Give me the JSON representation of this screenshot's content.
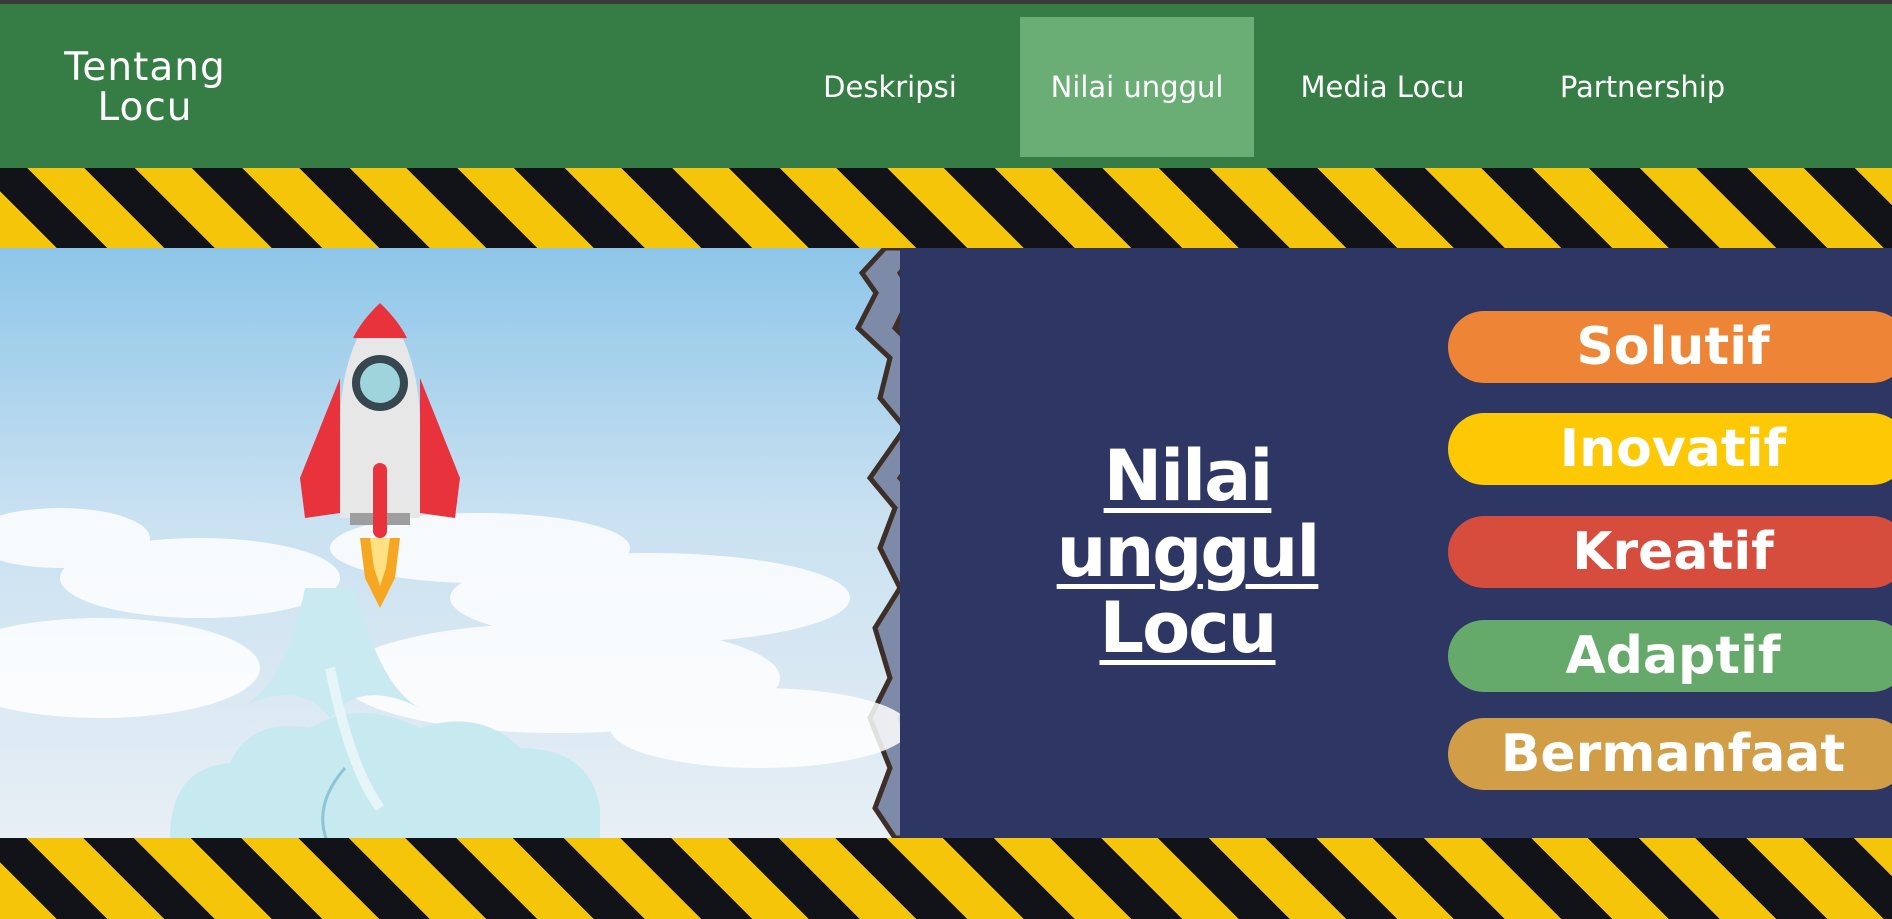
{
  "brand": {
    "line1": "Tentang",
    "line2": "Locu"
  },
  "nav": {
    "items": [
      {
        "label": "Deskripsi"
      },
      {
        "label": "Nilai unggul",
        "active": true
      },
      {
        "label": "Media Locu"
      },
      {
        "label": "Partnership"
      }
    ]
  },
  "hero": {
    "title_line1": "Nilai",
    "title_line2": "unggul",
    "title_line3": "Locu"
  },
  "values": [
    {
      "label": "Solutif",
      "color": "#ee8435"
    },
    {
      "label": "Inovatif",
      "color": "#fcc904"
    },
    {
      "label": "Kreatif",
      "color": "#d64d3e"
    },
    {
      "label": "Adaptif",
      "color": "#66aa6b"
    },
    {
      "label": "Bermanfaat",
      "color": "#d19d47"
    }
  ],
  "colors": {
    "nav_bg": "#357d44",
    "nav_active": "#6aad75",
    "hero_bg": "#2e3663",
    "stripe_yellow": "#f5c50a",
    "stripe_black": "#111318"
  },
  "icons": [
    "rocket-icon"
  ]
}
